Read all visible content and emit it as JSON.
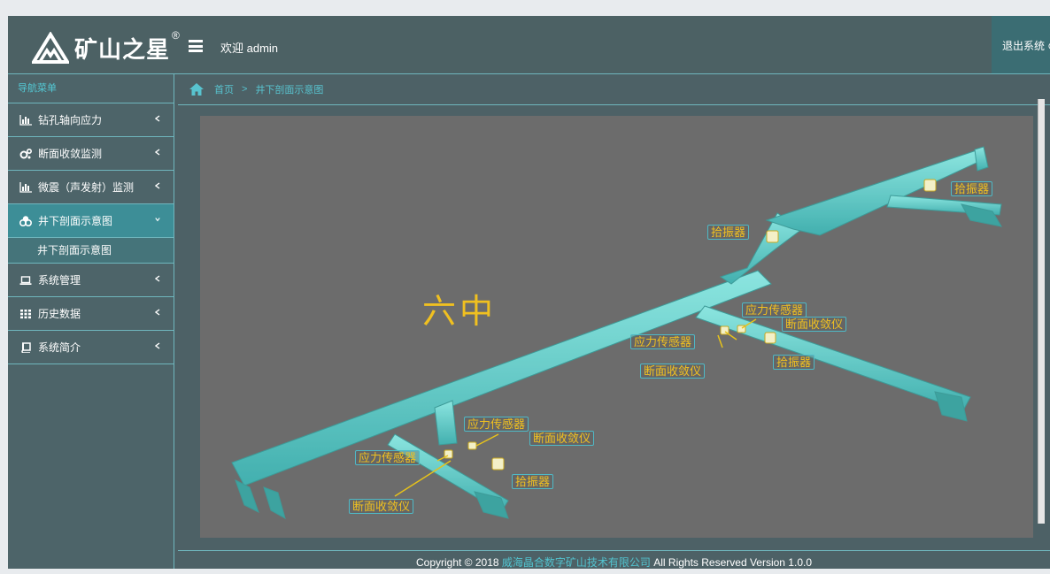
{
  "header": {
    "logo_text": "矿山之星",
    "logo_reg": "®",
    "welcome": "欢迎 admin",
    "logout": "退出系统 ⊙"
  },
  "sidebar": {
    "title": "导航菜单",
    "items": [
      {
        "label": "钻孔轴向应力",
        "icon": "bar-chart-icon"
      },
      {
        "label": "断面收敛监测",
        "icon": "gears-icon"
      },
      {
        "label": "微震（声发射）监测",
        "icon": "bar-chart-icon"
      },
      {
        "label": "井下剖面示意图",
        "icon": "cubes-icon",
        "active": true
      },
      {
        "label": "系统管理",
        "icon": "laptop-icon"
      },
      {
        "label": "历史数据",
        "icon": "grid-icon"
      },
      {
        "label": "系统简介",
        "icon": "book-icon"
      }
    ],
    "submenu": [
      "井下剖面示意图"
    ]
  },
  "breadcrumb": {
    "home": "首页",
    "sep": ">",
    "current": "井下剖面示意图"
  },
  "scene": {
    "main_label": "六中",
    "labels": {
      "pickup_1": "拾振器",
      "pickup_2": "拾振器",
      "stress_1": "应力传感器",
      "convergence_1": "断面收敛仪",
      "stress_2": "应力传感器",
      "convergence_2": "断面收敛仪",
      "pickup_3": "拾振器",
      "stress_3": "应力传感器",
      "convergence_3": "断面收敛仪",
      "stress_4": "应力传感器",
      "pickup_4": "拾振器",
      "convergence_4": "断面收敛仪"
    },
    "colors": {
      "tunnel": "#5ed4cf",
      "label_text": "#f0c020",
      "label_border": "#4fb9c6"
    }
  },
  "footer": {
    "prefix": "Copyright © 2018 ",
    "company": "威海晶合数字矿山技术有限公司",
    "suffix": " All Rights Reserved Version 1.0.0"
  }
}
